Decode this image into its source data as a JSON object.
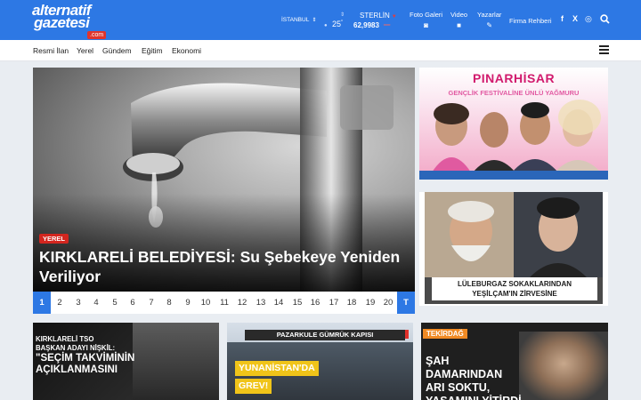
{
  "header": {
    "logo_line1": "alternatif",
    "logo_line2": "gazetesi",
    "logo_tld": ".com",
    "city": "İSTANBUL",
    "temperature": "25",
    "temp_unit": "°",
    "currency_label": "STERLİN",
    "currency_value": "62,9983",
    "nav": [
      {
        "label": "Foto Galeri",
        "icon": "camera-icon"
      },
      {
        "label": "Video",
        "icon": "video-icon"
      },
      {
        "label": "Yazarlar",
        "icon": "pen-icon"
      }
    ],
    "firma": "Firma Rehberi",
    "social": [
      "f",
      "X",
      "◎"
    ]
  },
  "subnav": [
    "Resmi İlan",
    "Yerel",
    "Gündem",
    "Eğitim",
    "Ekonomi"
  ],
  "hero": {
    "tag": "YEREL",
    "title": "KIRKLARELİ BELEDİYESİ: Su Şebekeye Yeniden Veriliyor",
    "pages": [
      "1",
      "2",
      "3",
      "4",
      "5",
      "6",
      "7",
      "8",
      "9",
      "10",
      "11",
      "12",
      "13",
      "14",
      "15",
      "16",
      "17",
      "18",
      "19",
      "20"
    ],
    "last_label": "T",
    "active_page": "1"
  },
  "ads": {
    "ad1_title": "PINARHİSAR",
    "ad1_subtitle": "GENÇLİK FESTİVALİNE ÜNLÜ YAĞMURU",
    "ad2_caption_1": "LÜLEBURGAZ SOKAKLARINDAN",
    "ad2_caption_2": "YEŞİLÇAM'IN ZİRVESİNE"
  },
  "cards": [
    {
      "line1": "KIRKLARELİ TSO",
      "line2": "BAŞKAN ADAYI NİŞKİL:",
      "line3": "\"SEÇİM TAKVİMİNİN",
      "line4": "AÇIKLANMASINI"
    },
    {
      "sign": "PAZARKULE GÜMRÜK KAPISI",
      "label1": "YUNANİSTAN'DA",
      "label2": "GREV!"
    },
    {
      "tag": "TEKİRDAĞ",
      "title": "ŞAH DAMARINDAN ARI SOKTU, YAŞAMINI YİTİRDİ"
    }
  ],
  "colors": {
    "brand_blue": "#2d78e4",
    "tag_red": "#d3261f",
    "festival_pink": "#d11a6d",
    "tekirdag_orange": "#f08a24",
    "yellow_label": "#f0c419"
  }
}
